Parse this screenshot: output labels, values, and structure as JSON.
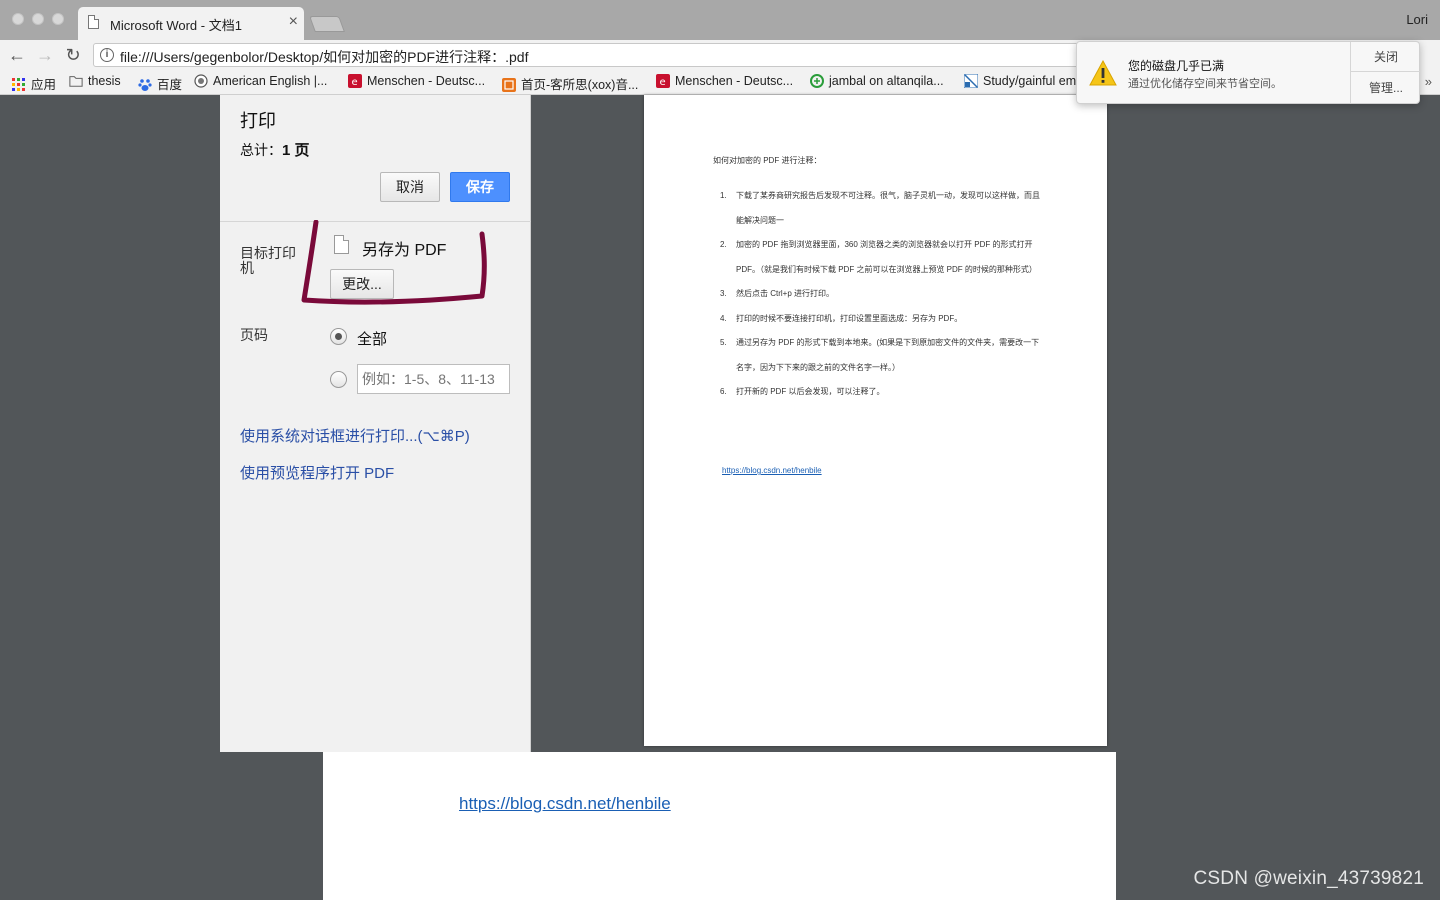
{
  "browser": {
    "tab_title": "Microsoft Word - 文档1",
    "tab_close": "×",
    "profile_name": "Lori",
    "url": "file:///Users/gegenbolor/Desktop/如何对加密的PDF进行注释：.pdf",
    "nav_back": "←",
    "nav_forward": "→",
    "nav_reload": "↻",
    "menu": "⋮"
  },
  "bookmarks": {
    "items": [
      {
        "label": "应用",
        "icon": "apps-grid-icon"
      },
      {
        "label": "thesis",
        "icon": "folder-icon"
      },
      {
        "label": "百度",
        "icon": "baidu-paw-icon"
      },
      {
        "label": "American English |...",
        "icon": "seal-icon"
      },
      {
        "label": "Menschen - Deutsc...",
        "icon": "red-e-icon"
      },
      {
        "label": "首页-客所思(xox)音...",
        "icon": "orange-site-icon"
      },
      {
        "label": "Menschen - Deutsc...",
        "icon": "red-e-icon"
      },
      {
        "label": "jambal on altanqila...",
        "icon": "green-circle-icon"
      },
      {
        "label": "Study/gainful em",
        "icon": "blue-chart-icon"
      }
    ],
    "more": "»"
  },
  "print_panel": {
    "title": "打印",
    "total_label": "总计：",
    "total_value": "1 页",
    "cancel_label": "取消",
    "save_label": "保存",
    "destination_label": "目标打印机",
    "destination_value": "另存为 PDF",
    "change_label": "更改...",
    "pages_label": "页码",
    "pages_all_label": "全部",
    "pages_placeholder": "例如：1-5、8、11-13",
    "system_dialog_link": "使用系统对话框进行打印...(⌥⌘P)",
    "preview_link": "使用预览程序打开 PDF"
  },
  "preview_doc": {
    "title": "如何对加密的 PDF 进行注释：",
    "items": [
      {
        "num": "1.",
        "text": "下载了某券商研究报告后发现不可注释。很气，脑子灵机一动，发现可以这样做，而且能解决问题一"
      },
      {
        "num": "2.",
        "text": "加密的 PDF 拖到浏览器里面，360 浏览器之类的浏览器就会以打开 PDF 的形式打开 PDF。（就是我们有时候下载 PDF 之前可以在浏览器上预览 PDF 的时候的那种形式）"
      },
      {
        "num": "3.",
        "text": "然后点击 Ctrl+p 进行打印。"
      },
      {
        "num": "4.",
        "text": "打印的时候不要连接打印机，打印设置里面选成：另存为 PDF。"
      },
      {
        "num": "5.",
        "text": "通过另存为 PDF 的形式下载到本地来。(如果是下到原加密文件的文件夹，需要改一下名字，因为下下来的跟之前的文件名字一样。）"
      },
      {
        "num": "6.",
        "text": "打开新的 PDF 以后会发现，可以注释了。"
      }
    ],
    "link": "https://blog.csdn.net/henbile"
  },
  "background_page": {
    "link": "https://blog.csdn.net/henbile"
  },
  "notification": {
    "title": "您的磁盘几乎已满",
    "body": "通过优化储存空间来节省空间。",
    "close_label": "关闭",
    "manage_label": "管理...",
    "icon": "warning-icon"
  },
  "watermark": "CSDN @weixin_43739821",
  "colors": {
    "save_button": "#4d90fe",
    "link": "#2a4fa6",
    "annotation_stroke": "#7a0a3a",
    "warning": "#f5c518"
  }
}
